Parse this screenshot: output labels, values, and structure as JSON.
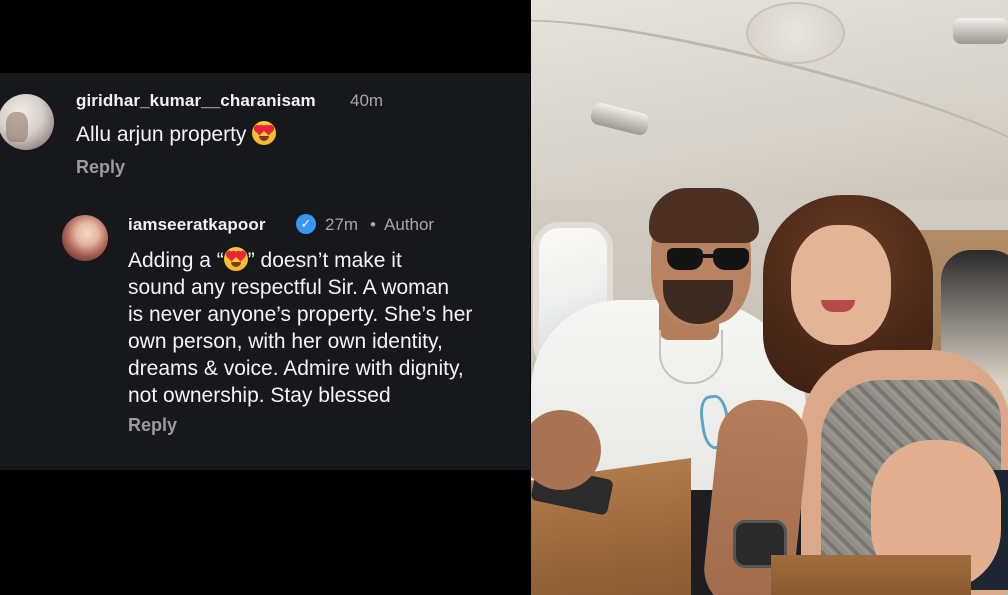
{
  "comments": [
    {
      "username": "giridhar_kumar__charanisam",
      "time": "40m",
      "text_before_emoji": "Allu arjun property ",
      "emoji": "smiling-face-with-heart-eyes",
      "reply_label": "Reply"
    }
  ],
  "reply": {
    "username": "iamseeratkapoor",
    "verified": true,
    "time": "27m",
    "separator": "•",
    "role": "Author",
    "line1_pre": "Adding a “",
    "line1_emoji": "smiling-face-with-heart-eyes",
    "line1_post": "” doesn’t make it",
    "line2": "sound any respectful Sir. A woman",
    "line3": "is never anyone’s property. She’s her",
    "line4": "own person, with her own identity,",
    "line5": "dreams & voice. Admire with dignity,",
    "line6": "not ownership. Stay blessed",
    "reply_label": "Reply"
  },
  "photo": {
    "scene": "private-jet-cabin"
  },
  "colors": {
    "panel_bg": "#17181c",
    "page_bg": "#000000",
    "username": "#f2f2f2",
    "muted": "#a6a6a6",
    "verified": "#3897f0"
  }
}
